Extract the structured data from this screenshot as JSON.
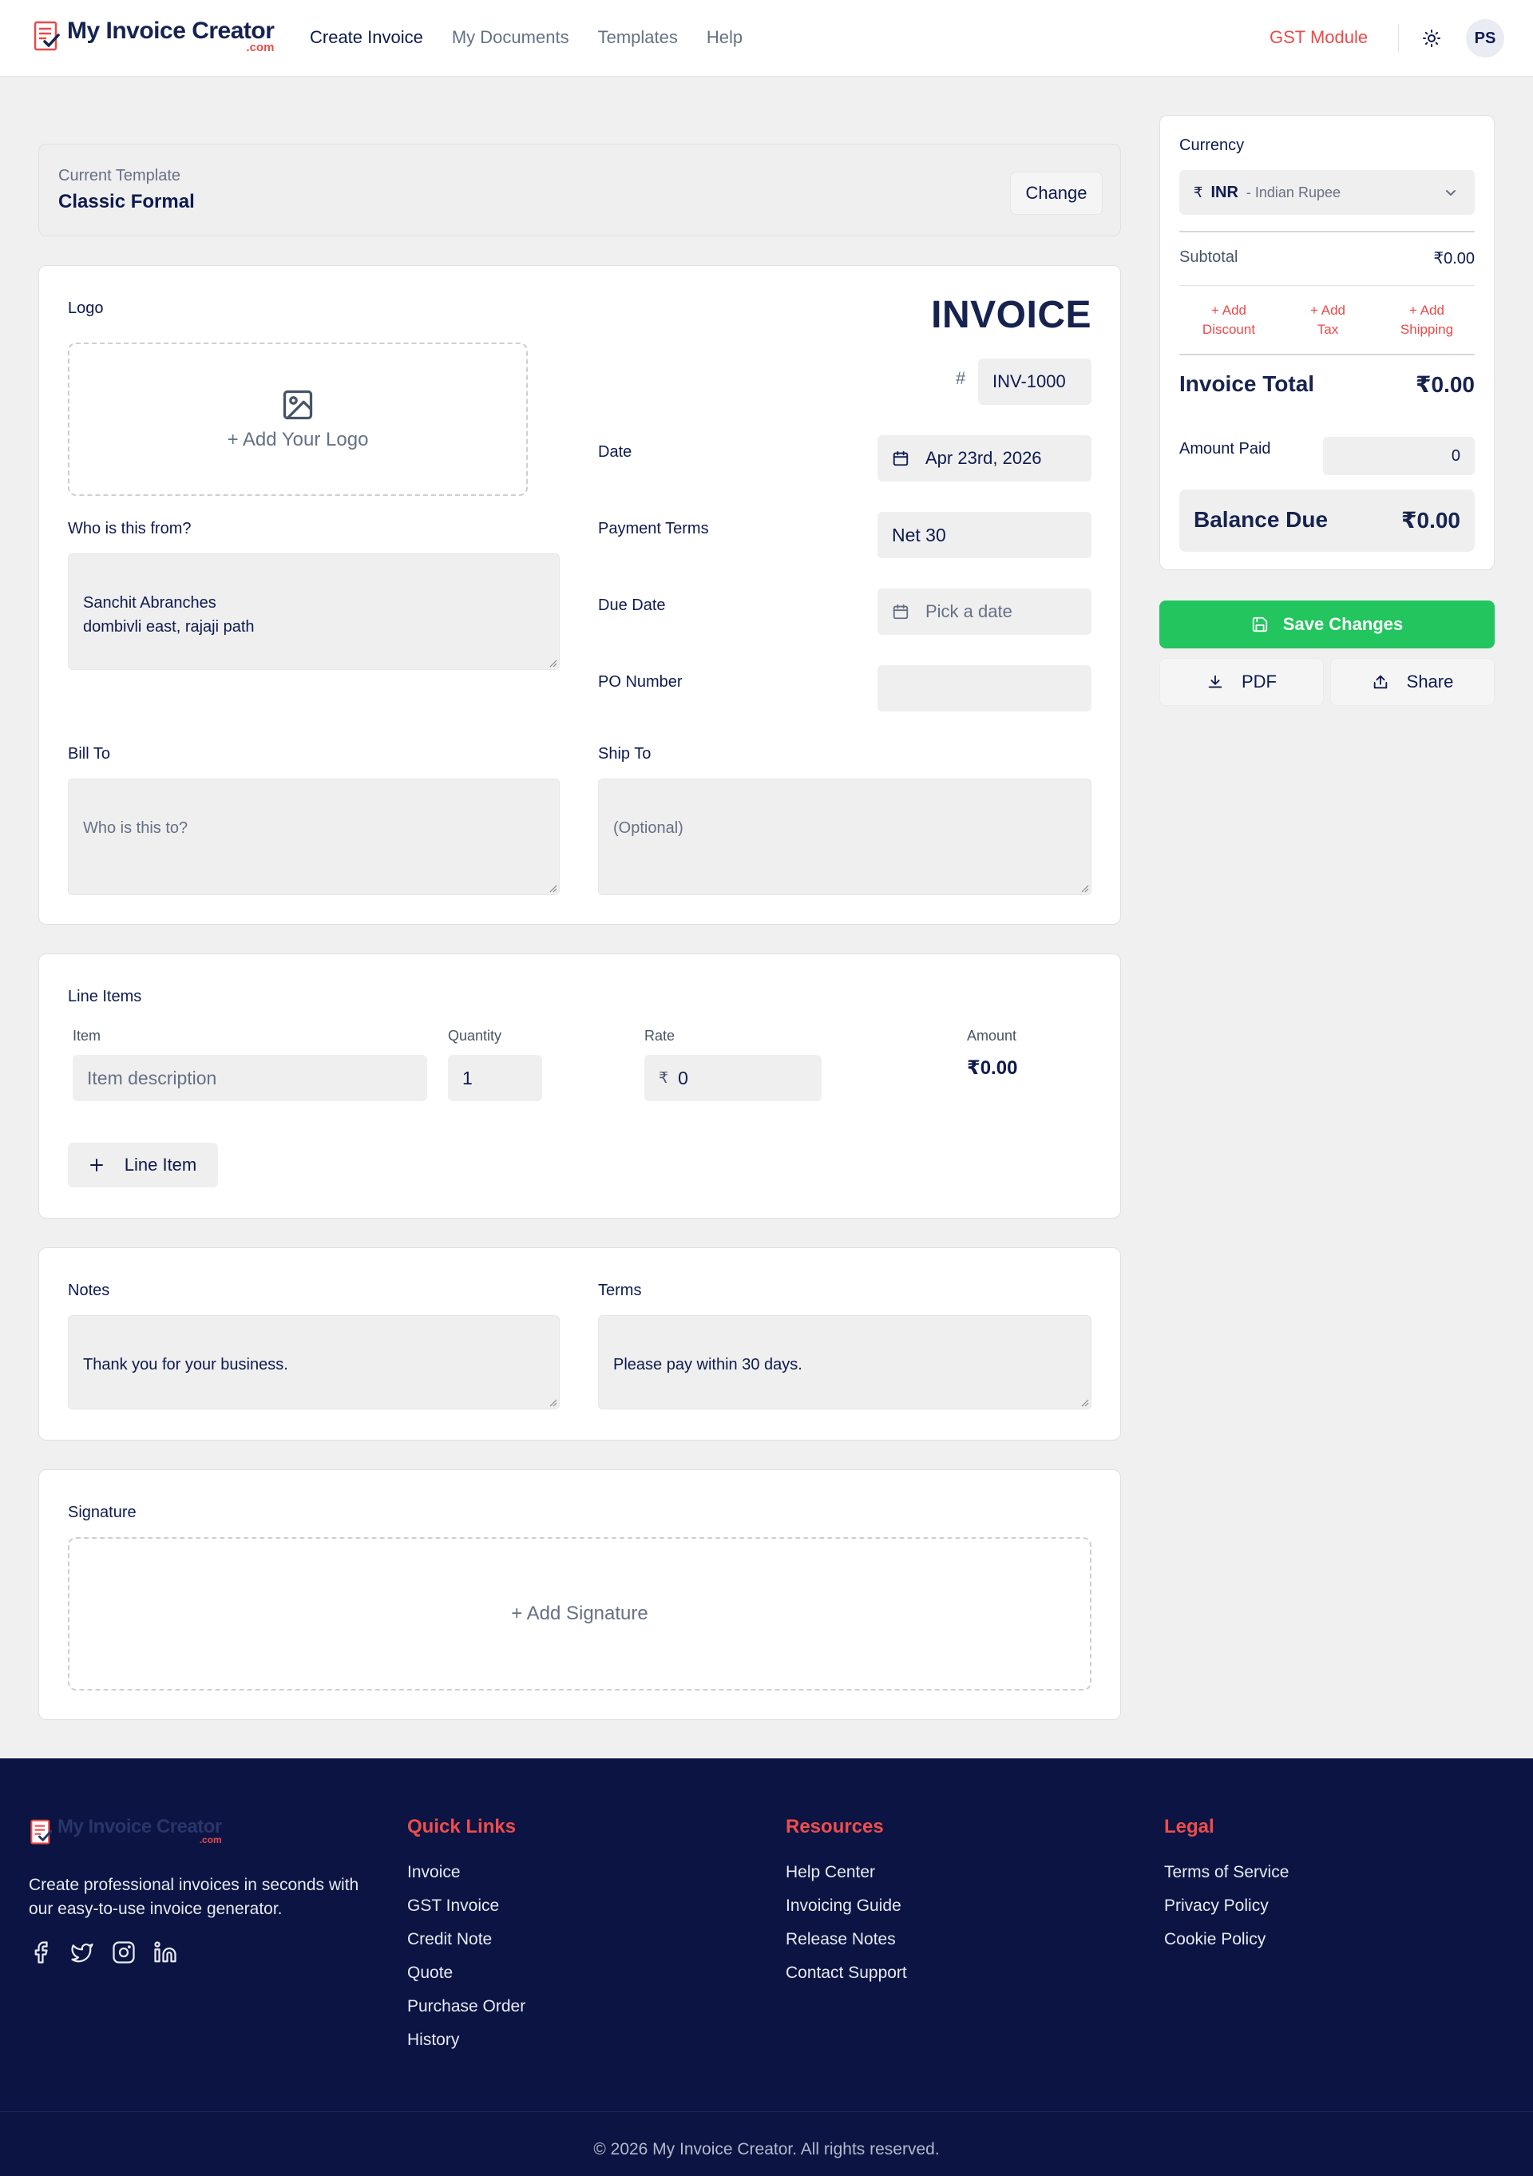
{
  "header": {
    "brand_name": "My Invoice Creator",
    "brand_suffix": ".com",
    "nav": [
      "Create Invoice",
      "My Documents",
      "Templates",
      "Help"
    ],
    "gst_link": "GST Module",
    "avatar_initials": "PS",
    "accent_color": "#ea4a4a"
  },
  "template": {
    "caption": "Current Template",
    "name": "Classic Formal",
    "change_label": "Change"
  },
  "invoice": {
    "logo_label": "Logo",
    "logo_placeholder": "+ Add Your Logo",
    "title": "INVOICE",
    "hash": "#",
    "number": "INV-1000",
    "date_label": "Date",
    "date_value": "Apr 23rd, 2026",
    "terms_label": "Payment Terms",
    "terms_value": "Net 30",
    "due_label": "Due Date",
    "due_placeholder": "Pick a date",
    "po_label": "PO Number",
    "po_value": "",
    "from_label": "Who is this from?",
    "from_value": "Sanchit Abranches\ndombivli east, rajaji path",
    "bill_label": "Bill To",
    "bill_placeholder": "Who is this to?",
    "ship_label": "Ship To",
    "ship_placeholder": "(Optional)"
  },
  "line_items": {
    "title": "Line Items",
    "columns": [
      "Item",
      "Quantity",
      "Rate",
      "Amount"
    ],
    "rows": [
      {
        "item_placeholder": "Item description",
        "quantity": "1",
        "rate_symbol": "₹",
        "rate": "0",
        "amount": "₹0.00"
      }
    ],
    "add_label": "Line Item"
  },
  "notes": {
    "notes_label": "Notes",
    "notes_value": "Thank you for your business.",
    "terms_label": "Terms",
    "terms_value": "Please pay within 30 days."
  },
  "signature": {
    "label": "Signature",
    "placeholder": "+ Add Signature"
  },
  "summary": {
    "currency_label": "Currency",
    "currency_symbol": "₹",
    "currency_code": "INR",
    "currency_desc": "- Indian Rupee",
    "subtotal_label": "Subtotal",
    "subtotal_value": "₹0.00",
    "add_discount": "+ Add\nDiscount",
    "add_tax": "+ Add\nTax",
    "add_shipping": "+ Add\nShipping",
    "total_label": "Invoice Total",
    "total_value": "₹0.00",
    "paid_label": "Amount Paid",
    "paid_value": "0",
    "balance_label": "Balance Due",
    "balance_value": "₹0.00"
  },
  "actions": {
    "save_label": "Save Changes",
    "pdf_label": "PDF",
    "share_label": "Share",
    "save_color": "#22c55e"
  },
  "footer": {
    "brand_name": "My Invoice Creator",
    "brand_suffix": ".com",
    "tagline": "Create professional invoices in seconds with our easy-to-use invoice generator.",
    "social_icons": [
      "facebook-icon",
      "twitter-icon",
      "instagram-icon",
      "linkedin-icon"
    ],
    "quick_links_title": "Quick Links",
    "quick_links": [
      "Invoice",
      "GST Invoice",
      "Credit Note",
      "Quote",
      "Purchase Order",
      "History"
    ],
    "resources_title": "Resources",
    "resources": [
      "Help Center",
      "Invoicing Guide",
      "Release Notes",
      "Contact Support"
    ],
    "legal_title": "Legal",
    "legal": [
      "Terms of Service",
      "Privacy Policy",
      "Cookie Policy"
    ],
    "copyright": "© 2026 My Invoice Creator. All rights reserved.",
    "background_color": "#0b1442"
  }
}
